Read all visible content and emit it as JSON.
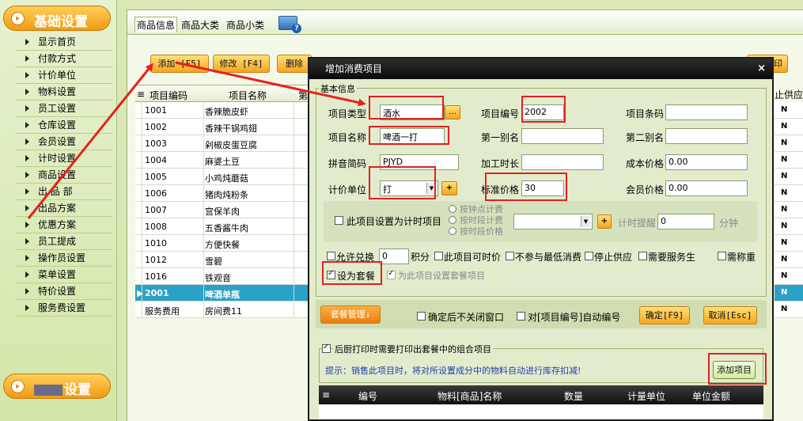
{
  "sidebar": {
    "header_top": "基础设置",
    "header_bottom": "设置",
    "items": [
      "显示首页",
      "付款方式",
      "计价单位",
      "物料设置",
      "员工设置",
      "仓库设置",
      "会员设置",
      "计时设置",
      "商品设置",
      "出 品 部",
      "出品方案",
      "优惠方案",
      "员工提成",
      "操作员设置",
      "菜单设置",
      "特价设置",
      "服务费设置"
    ]
  },
  "tabs": [
    "商品信息",
    "商品大类",
    "商品小类"
  ],
  "toolbar": {
    "add": "添加 [F5]",
    "edit": "修改 [F4]",
    "delete": "删除",
    "print": "印"
  },
  "grid": {
    "headers": [
      "项目编码",
      "项目名称",
      "第"
    ],
    "rows": [
      [
        "1001",
        "香辣脆皮虾"
      ],
      [
        "1002",
        "香辣干锅鸡翅"
      ],
      [
        "1003",
        "剁椒皮蛋豆腐"
      ],
      [
        "1004",
        "麻婆土豆"
      ],
      [
        "1005",
        "小鸡炖蘑菇"
      ],
      [
        "1006",
        "猪肉炖粉条"
      ],
      [
        "1007",
        "宫保羊肉"
      ],
      [
        "1008",
        "五香酱牛肉"
      ],
      [
        "1010",
        "方便快餐"
      ],
      [
        "1012",
        "雪碧"
      ],
      [
        "1016",
        "铁观音"
      ],
      [
        "2001",
        "啤酒单瓶"
      ],
      [
        "服务费用",
        "房间费11"
      ]
    ],
    "selected_index": 11,
    "right_header": "止供应",
    "right_values": [
      "N",
      "N",
      "N",
      "N",
      "N",
      "N",
      "N",
      "N",
      "N",
      "N",
      "N",
      "N",
      "N"
    ]
  },
  "dialog": {
    "title": "增加消费项目",
    "close": "×",
    "group_label": "基本信息",
    "labels": {
      "type": "项目类型",
      "code": "项目编号",
      "barcode": "项目条码",
      "name": "项目名称",
      "alias1": "第一别名",
      "alias2": "第二别名",
      "pinyin": "拼音简码",
      "time": "加工时长",
      "cost": "成本价格",
      "unit": "计价单位",
      "price": "标准价格",
      "member_price": "会员价格",
      "timed": "此项目设置为计时项目",
      "r1": "按钟点计费",
      "r2": "按时段计费",
      "r3": "按时段价格",
      "remind": "计时提醒",
      "minute": "分钟",
      "exchange": "允许兑换",
      "points": "积分",
      "editable_price": "此项目可时价",
      "no_min": "不参与最低消费",
      "stop_supply": "停止供应",
      "need_service": "需要服务生",
      "need_weigh": "需称重",
      "set_combo": "设为套餐",
      "set_combo_items": "为此项目设置套餐项目"
    },
    "values": {
      "type": "酒水",
      "code": "2002",
      "name": "啤酒一打",
      "pinyin": "PJYD",
      "cost": "0.00",
      "unit": "打",
      "price": "30",
      "member_price": "0.00",
      "remind": "0",
      "exchange": "0"
    },
    "buttons": {
      "combo_manage": "套餐管理↓",
      "keep_open": "确定后不关闭窗口",
      "auto_code": "对[项目编号]自动编号",
      "ok": "确定[F9]",
      "cancel": "取消[Esc]",
      "ellipsis": "...",
      "plus": "+",
      "add_item": "添加项目"
    },
    "kitchen": {
      "label": "后厨打印时需要打印出套餐中的组合项目",
      "hint": "提示：销售此项目时，将对所设置成分中的物料自动进行库存扣减!",
      "columns": [
        "编号",
        "物料[商品]名称",
        "数量",
        "计量单位",
        "单位金额"
      ]
    }
  },
  "colors": {
    "accent_orange": "#f3a520",
    "highlight_red": "#e02020",
    "selected_row": "#2aa1c7"
  }
}
